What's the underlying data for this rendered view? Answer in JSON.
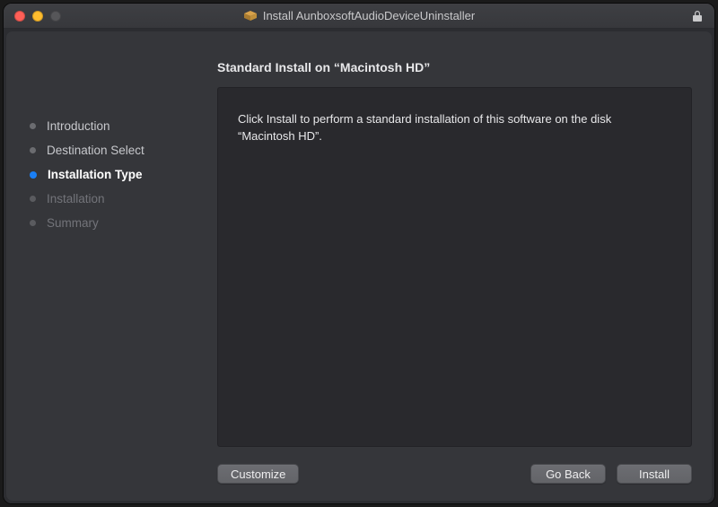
{
  "window": {
    "title": "Install AunboxsoftAudioDeviceUninstaller"
  },
  "sidebar": {
    "steps": [
      {
        "label": "Introduction",
        "state": "completed"
      },
      {
        "label": "Destination Select",
        "state": "completed"
      },
      {
        "label": "Installation Type",
        "state": "active"
      },
      {
        "label": "Installation",
        "state": "pending"
      },
      {
        "label": "Summary",
        "state": "pending"
      }
    ]
  },
  "panel": {
    "heading": "Standard Install on “Macintosh HD”",
    "body": "Click Install to perform a standard installation of this software on the disk “Macintosh HD”."
  },
  "buttons": {
    "customize": "Customize",
    "goback": "Go Back",
    "install": "Install"
  }
}
